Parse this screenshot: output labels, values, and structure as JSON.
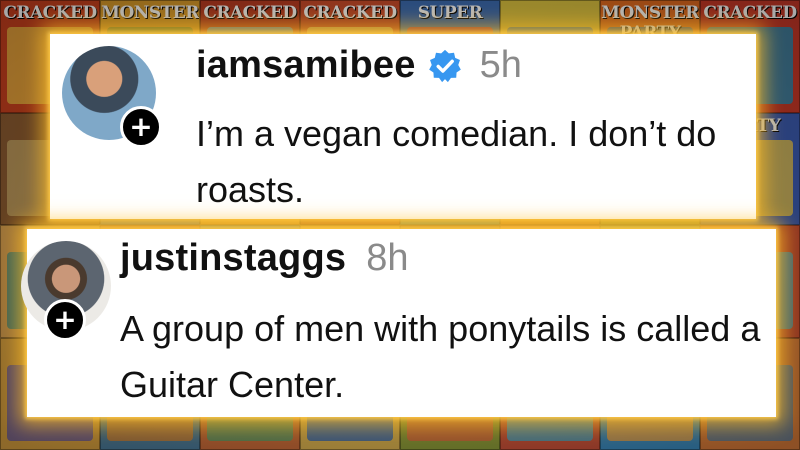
{
  "background": {
    "covers": [
      {
        "masthead": "CRACKED",
        "color": "#c8401e",
        "art": "#e8b040"
      },
      {
        "masthead": "MONSTER",
        "color": "#d89a2a",
        "art": "#6a8a3a"
      },
      {
        "masthead": "CRACKED",
        "color": "#b83a22",
        "art": "#5aa0c8"
      },
      {
        "masthead": "CRACKED",
        "color": "#c84a2a",
        "art": "#e0c060"
      },
      {
        "masthead": "SUPER",
        "color": "#3a6ab0",
        "art": "#c84040"
      },
      {
        "masthead": "",
        "color": "#d8c040",
        "art": "#4a80a0"
      },
      {
        "masthead": "MONSTER PARTY",
        "color": "#e06a20",
        "art": "#3a6a9a"
      },
      {
        "masthead": "CRACKED",
        "color": "#c83828",
        "art": "#2a8ab0"
      },
      {
        "masthead": "",
        "color": "#8a5a30",
        "art": "#c0a060"
      },
      {
        "masthead": "",
        "color": "#4a7ab8",
        "art": "#d86a30"
      },
      {
        "masthead": "",
        "color": "#d89a3a",
        "art": "#6a9a4a"
      },
      {
        "masthead": "",
        "color": "#a84a2a",
        "art": "#e0b050"
      },
      {
        "masthead": "",
        "color": "#3a8a9a",
        "art": "#c84a4a"
      },
      {
        "masthead": "",
        "color": "#c87a2a",
        "art": "#5a7ab0"
      },
      {
        "masthead": "",
        "color": "#7a9a3a",
        "art": "#d8a040"
      },
      {
        "masthead": "PARTY",
        "color": "#3a5ab0",
        "art": "#e0c050"
      },
      {
        "masthead": "",
        "color": "#d8a050",
        "art": "#4a8a7a"
      },
      {
        "masthead": "",
        "color": "#b85a30",
        "art": "#6a9ac0"
      },
      {
        "masthead": "",
        "color": "#4a8aa8",
        "art": "#c86a3a"
      },
      {
        "masthead": "",
        "color": "#c8903a",
        "art": "#5a6ab0"
      },
      {
        "masthead": "",
        "color": "#8a6a3a",
        "art": "#d8b050"
      },
      {
        "masthead": "",
        "color": "#d86a30",
        "art": "#3a7a9a"
      },
      {
        "masthead": "",
        "color": "#5a9a5a",
        "art": "#e0a040"
      },
      {
        "masthead": "",
        "color": "#c84a30",
        "art": "#4a9ab0"
      },
      {
        "masthead": "",
        "color": "#d8a040",
        "art": "#6a5a9a"
      },
      {
        "masthead": "",
        "color": "#4a7a9a",
        "art": "#c8803a"
      },
      {
        "masthead": "",
        "color": "#c86a3a",
        "art": "#5a9a6a"
      },
      {
        "masthead": "",
        "color": "#d8b050",
        "art": "#3a6ab0"
      },
      {
        "masthead": "",
        "color": "#8a9a3a",
        "art": "#d86a40"
      },
      {
        "masthead": "",
        "color": "#c8503a",
        "art": "#4aa0c0"
      },
      {
        "masthead": "",
        "color": "#3a8ac0",
        "art": "#e0a050"
      },
      {
        "masthead": "",
        "color": "#d87a3a",
        "art": "#5a7a9a"
      }
    ]
  },
  "comments": [
    {
      "username": "iamsamibee",
      "verified": true,
      "timestamp": "5h",
      "text": "I’m a vegan comedian. I don’t do roasts.",
      "follow_symbol": "+"
    },
    {
      "username": "justinstaggs",
      "verified": false,
      "timestamp": "8h",
      "text": "A group of men with ponytails is called a Guitar Center.",
      "follow_symbol": "+"
    }
  ],
  "colors": {
    "verified_badge": "#3797f0",
    "glow": "#ffbe28",
    "timestamp": "#8a8a8a"
  }
}
